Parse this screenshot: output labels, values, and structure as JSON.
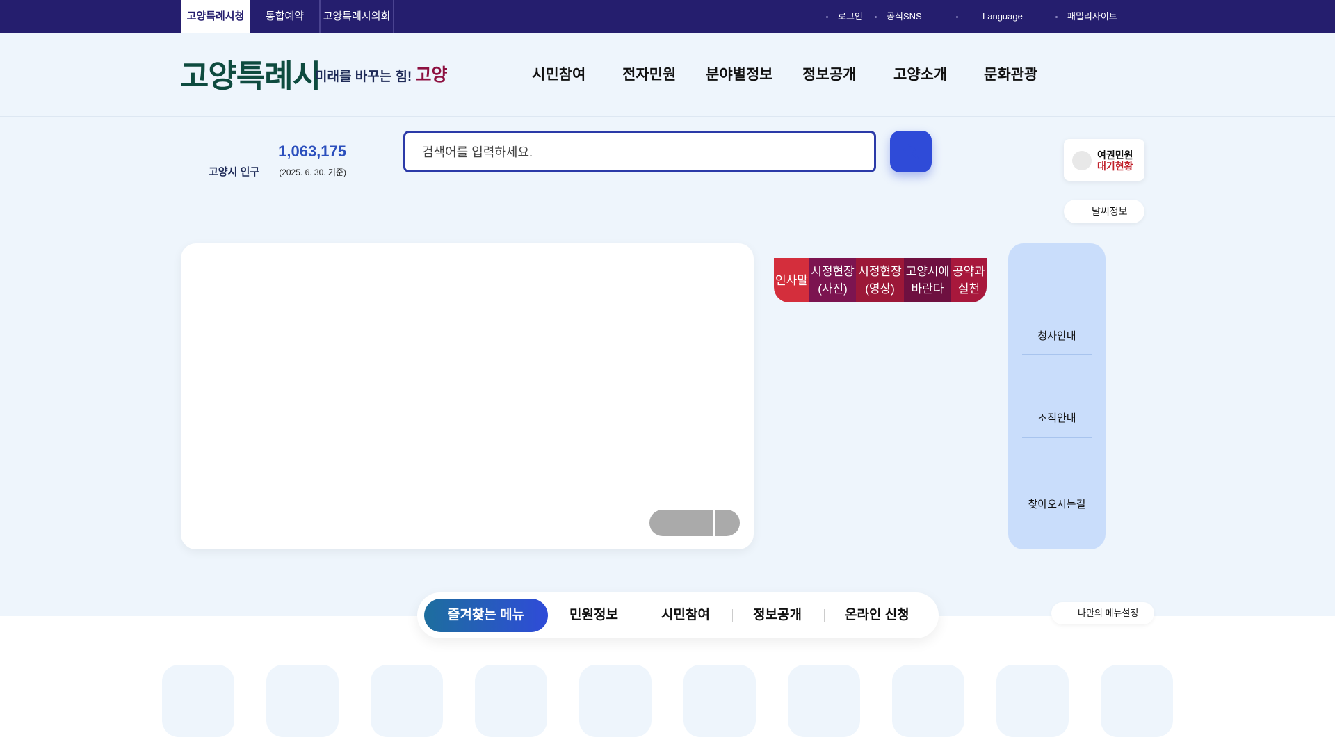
{
  "topbar": {
    "tabs": [
      {
        "label": "고양특례시청",
        "active": true
      },
      {
        "label": "통합예약",
        "active": false
      },
      {
        "label": "고양특례시의회",
        "active": false
      }
    ],
    "utility": [
      "로그인",
      "공식SNS",
      "Language",
      "패밀리사이트"
    ]
  },
  "header": {
    "logo_text": "고양특례시",
    "slogan": {
      "part1": "미래를 바꾸는 힘!",
      "part2": "고양"
    },
    "nav": [
      "시민참여",
      "전자민원",
      "분야별정보",
      "정보공개",
      "고양소개",
      "문화관광"
    ]
  },
  "population": {
    "label": "고양시 인구",
    "value": "1,063,175",
    "date": "(2025. 6. 30. 기준)"
  },
  "search": {
    "placeholder": "검색어를 입력하세요."
  },
  "quick": {
    "passport_line1": "여권민원",
    "passport_line2": "대기현황",
    "weather": "날씨정보"
  },
  "news_tabs": [
    {
      "label": "인사말",
      "color": "#d42e3c"
    },
    {
      "label": "시정현장(사진)",
      "color": "#7c1450"
    },
    {
      "label": "시정현장(영상)",
      "color": "#9c1838"
    },
    {
      "label": "고양시에 바란다",
      "color": "#6e1040"
    },
    {
      "label": "공약과 실천",
      "color": "#a8183c"
    }
  ],
  "side_panel": [
    "청사안내",
    "조직안내",
    "찾아오시는길"
  ],
  "favorites": {
    "tabs": [
      "즐겨찾는 메뉴",
      "민원정보",
      "시민참여",
      "정보공개",
      "온라인 신청"
    ],
    "my_menu": "나만의 메뉴설정"
  }
}
